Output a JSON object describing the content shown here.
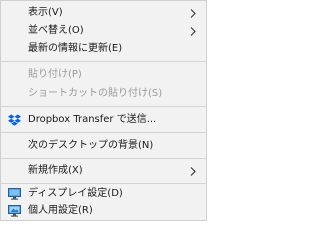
{
  "context_menu": {
    "view": {
      "label": "表示(V)",
      "icon": "chevron-right"
    },
    "sort_by": {
      "label": "並べ替え(O)",
      "icon": "chevron-right"
    },
    "refresh": {
      "label": "最新の情報に更新(E)"
    },
    "paste": {
      "label": "貼り付け(P)",
      "disabled": true
    },
    "paste_shortcut": {
      "label": "ショートカットの貼り付け(S)",
      "disabled": true
    },
    "dropbox_transfer": {
      "label": "Dropbox Transfer で送信...",
      "icon": "dropbox-icon",
      "icon_color": "#0061FE"
    },
    "next_background": {
      "label": "次のデスクトップの背景(N)"
    },
    "new": {
      "label": "新規作成(X)",
      "icon": "chevron-right"
    },
    "display_settings": {
      "label": "ディスプレイ設定(D)",
      "icon": "display-icon"
    },
    "personalize": {
      "label": "個人用設定(R)",
      "icon": "personalize-icon"
    }
  }
}
